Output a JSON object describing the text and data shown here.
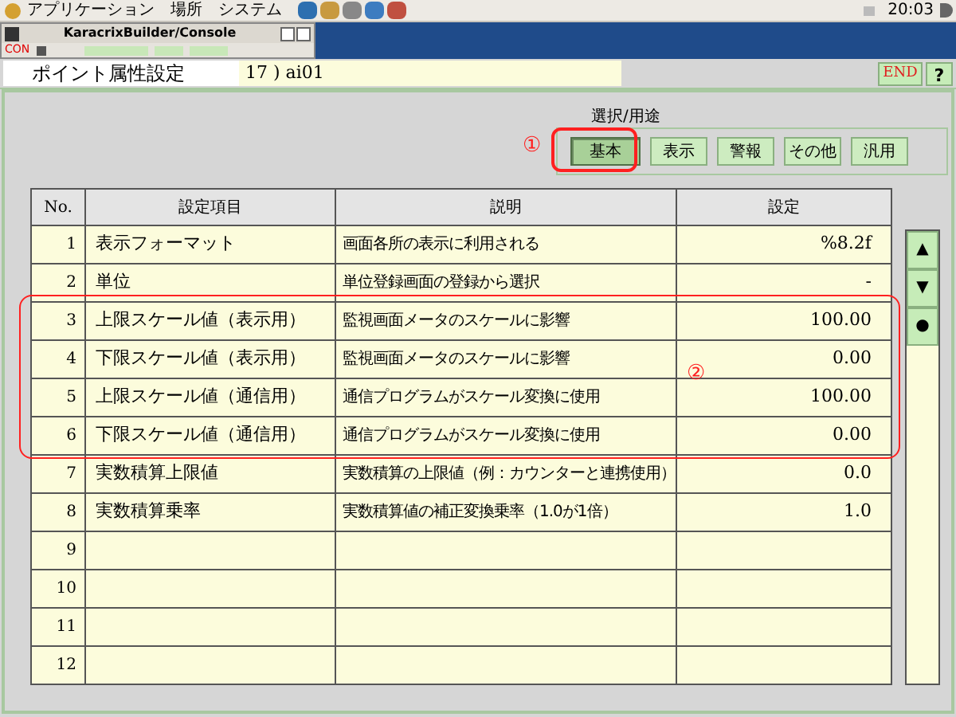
{
  "top_panel": {
    "menus": [
      "アプリケーション",
      "場所",
      "システム"
    ],
    "clock": "20:03"
  },
  "console_window": {
    "title": "KaracrixBuilder/Console",
    "toolbar_label": "CON"
  },
  "header": {
    "title": "ポイント属性設定",
    "point": "17 ) ai01",
    "end_button": "END",
    "help_button": "?"
  },
  "category": {
    "label": "選択/用途",
    "buttons": [
      {
        "label": "基本",
        "selected": true
      },
      {
        "label": "表示",
        "selected": false
      },
      {
        "label": "警報",
        "selected": false
      },
      {
        "label": "その他",
        "selected": false
      },
      {
        "label": "汎用",
        "selected": false
      }
    ]
  },
  "table": {
    "columns": [
      "No.",
      "設定項目",
      "説明",
      "設定"
    ],
    "rows": [
      {
        "no": "1",
        "item": "表示フォーマット",
        "description": "画面各所の表示に利用される",
        "value": "%8.2f"
      },
      {
        "no": "2",
        "item": "単位",
        "description": "単位登録画面の登録から選択",
        "value": "-"
      },
      {
        "no": "3",
        "item": "上限スケール値（表示用）",
        "description": "監視画面メータのスケールに影響",
        "value": "100.00"
      },
      {
        "no": "4",
        "item": "下限スケール値（表示用）",
        "description": "監視画面メータのスケールに影響",
        "value": "0.00"
      },
      {
        "no": "5",
        "item": "上限スケール値（通信用）",
        "description": "通信プログラムがスケール変換に使用",
        "value": "100.00"
      },
      {
        "no": "6",
        "item": "下限スケール値（通信用）",
        "description": "通信プログラムがスケール変換に使用",
        "value": "0.00"
      },
      {
        "no": "7",
        "item": "実数積算上限値",
        "description": "実数積算の上限値（例：カウンターと連携使用）",
        "value": "0.0"
      },
      {
        "no": "8",
        "item": "実数積算乗率",
        "description": "実数積算値の補正変換乗率（1.0が1倍）",
        "value": "1.0"
      },
      {
        "no": "9",
        "item": "",
        "description": "",
        "value": ""
      },
      {
        "no": "10",
        "item": "",
        "description": "",
        "value": ""
      },
      {
        "no": "11",
        "item": "",
        "description": "",
        "value": ""
      },
      {
        "no": "12",
        "item": "",
        "description": "",
        "value": ""
      }
    ]
  },
  "scroll_buttons": [
    "▲",
    "▼",
    "●"
  ],
  "annotations": [
    "①",
    "②"
  ]
}
